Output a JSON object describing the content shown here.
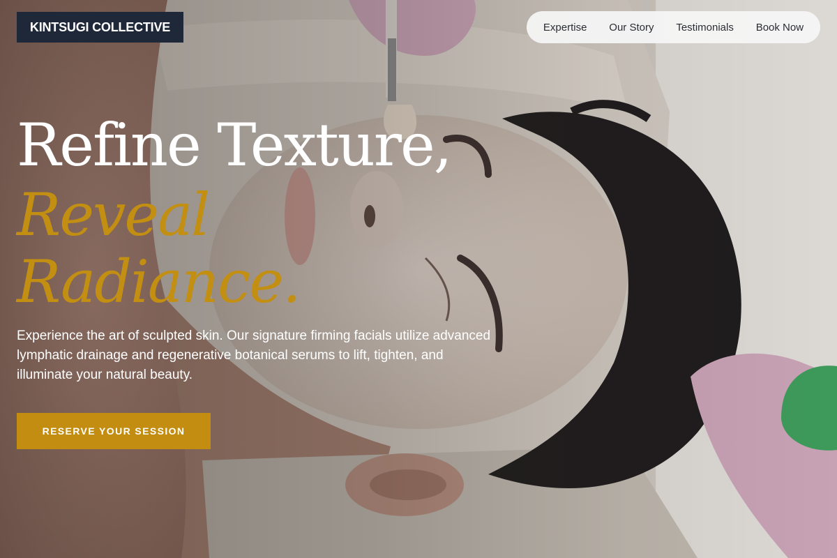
{
  "brand": {
    "name": "KINTSUGI COLLECTIVE",
    "logo_bg": "#1e2838"
  },
  "nav": {
    "items": [
      {
        "label": "Expertise"
      },
      {
        "label": "Our Story"
      },
      {
        "label": "Testimonials"
      },
      {
        "label": "Book Now"
      }
    ]
  },
  "hero": {
    "headline_line1": "Refine Texture,",
    "headline_line2": "Reveal",
    "headline_line3": "Radiance.",
    "accent_color": "#c28f12",
    "description": "Experience the art of sculpted skin. Our signature firming facials utilize advanced lymphatic drainage and regenerative botanical serums to lift, tighten, and illuminate your natural beauty.",
    "cta_label": "RESERVE YOUR SESSION"
  }
}
